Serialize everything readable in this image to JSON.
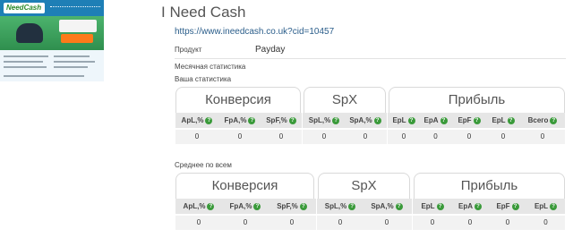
{
  "thumbnail": {
    "logo_text": "NeedCash"
  },
  "page": {
    "title": "I Need Cash",
    "url": "https://www.ineedcash.co.uk?cid=10457",
    "product_label": "Продукт",
    "product_value": "Payday",
    "monthly_stats_label": "Месячная статистика",
    "your_stats_label": "Ваша статистика",
    "average_label": "Среднее по всем"
  },
  "tables": {
    "your": {
      "groups": [
        "Конверсия",
        "SpX",
        "Прибыль"
      ],
      "columns": [
        "ApL,%",
        "FpA,%",
        "SpF,%",
        "SpL,%",
        "SpA,%",
        "EpL",
        "EpA",
        "EpF",
        "EpL",
        "Всего"
      ],
      "values": [
        "0",
        "0",
        "0",
        "0",
        "0",
        "0",
        "0",
        "0",
        "0",
        "0"
      ]
    },
    "average": {
      "groups": [
        "Конверсия",
        "SpX",
        "Прибыль"
      ],
      "columns": [
        "ApL,%",
        "FpA,%",
        "SpF,%",
        "SpL,%",
        "SpA,%",
        "EpL",
        "EpA",
        "EpF",
        "EpL"
      ],
      "values": [
        "0",
        "0",
        "0",
        "0",
        "0",
        "0",
        "0",
        "0",
        "0"
      ]
    }
  },
  "colors": {
    "help_icon": "#3a9a3a",
    "header_bg": "#e6e6e6",
    "url": "#2a5d8a"
  },
  "icons": {
    "help": "question-circle-icon"
  }
}
